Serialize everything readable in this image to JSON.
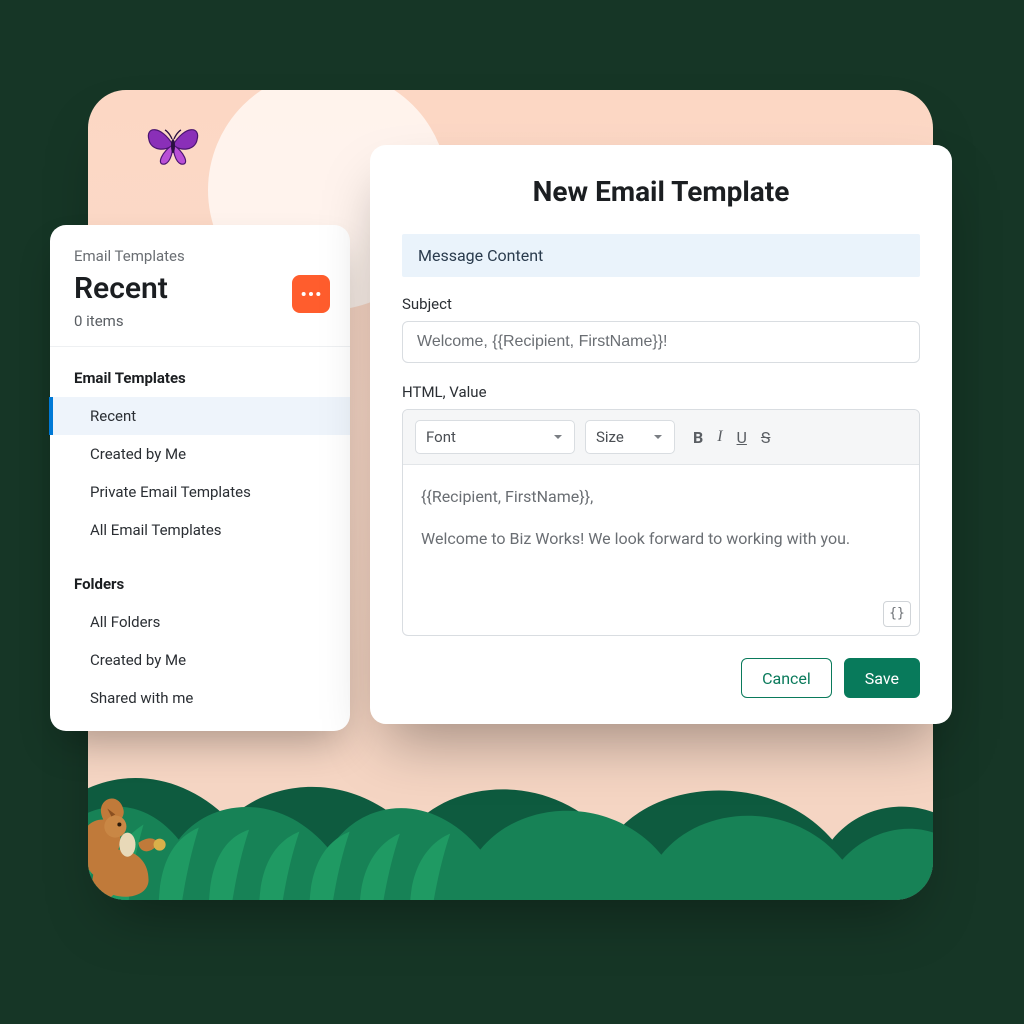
{
  "sidebar": {
    "breadcrumb": "Email Templates",
    "title": "Recent",
    "count": "0 items",
    "more_icon": "more-horizontal-icon",
    "sections": [
      {
        "label": "Email Templates",
        "items": [
          {
            "label": "Recent",
            "active": true
          },
          {
            "label": "Created by Me",
            "active": false
          },
          {
            "label": "Private Email Templates",
            "active": false
          },
          {
            "label": "All Email Templates",
            "active": false
          }
        ]
      },
      {
        "label": "Folders",
        "items": [
          {
            "label": "All Folders",
            "active": false
          },
          {
            "label": "Created by Me",
            "active": false
          },
          {
            "label": "Shared with me",
            "active": false
          }
        ]
      }
    ]
  },
  "modal": {
    "title": "New Email Template",
    "section_banner": "Message Content",
    "subject_label": "Subject",
    "subject_value": "Welcome, {{Recipient, FirstName}}!",
    "html_label": "HTML, Value",
    "toolbar": {
      "font_label": "Font",
      "size_label": "Size",
      "format_icons": [
        "bold",
        "italic",
        "underline",
        "strikethrough"
      ]
    },
    "body_line1": "{{Recipient, FirstName}},",
    "body_line2": "Welcome to Biz Works! We look forward to working with you.",
    "merge_button_label": "{}",
    "cancel_label": "Cancel",
    "save_label": "Save"
  },
  "colors": {
    "accent_orange": "#ff5d2d",
    "accent_green": "#087a5b",
    "selection_blue": "#eef4fb"
  }
}
